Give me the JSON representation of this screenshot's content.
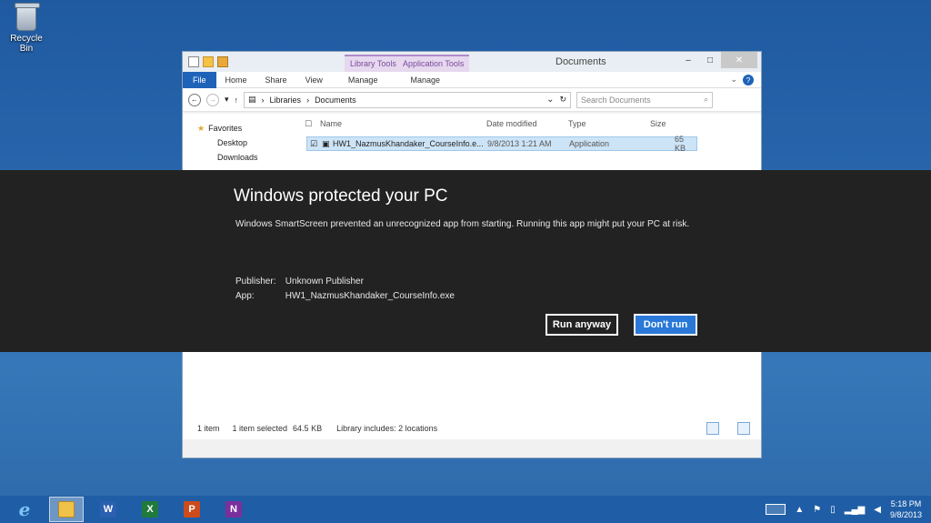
{
  "desktop": {
    "recycle_bin_label": "Recycle Bin"
  },
  "explorer": {
    "title": "Documents",
    "contextual_tabs": [
      "Library Tools",
      "Application Tools"
    ],
    "ribbon_tabs": [
      "File",
      "Home",
      "Share",
      "View",
      "Manage",
      "Manage"
    ],
    "path": [
      "Libraries",
      "Documents"
    ],
    "search_placeholder": "Search Documents",
    "nav_pane": {
      "favorites": "Favorites",
      "items": [
        "Desktop",
        "Downloads"
      ]
    },
    "columns": [
      "Name",
      "Date modified",
      "Type",
      "Size"
    ],
    "files": [
      {
        "name": "HW1_NazmusKhandaker_CourseInfo.e...",
        "date_modified": "9/8/2013 1:21 AM",
        "type": "Application",
        "size": "65 KB",
        "selected": true
      }
    ],
    "status": {
      "count": "1 item",
      "selection": "1 item selected",
      "size": "64.5 KB",
      "library": "Library includes: 2 locations"
    }
  },
  "smartscreen": {
    "title": "Windows protected your PC",
    "message": "Windows SmartScreen prevented an unrecognized app from starting. Running this app might put your PC at risk.",
    "publisher_label": "Publisher:",
    "publisher_value": "Unknown Publisher",
    "app_label": "App:",
    "app_value": "HW1_NazmusKhandaker_CourseInfo.exe",
    "run_anyway_label": "Run anyway",
    "dont_run_label": "Don't run"
  },
  "taskbar": {
    "apps": [
      {
        "icon": "internet-explorer-icon",
        "glyph": "e"
      },
      {
        "icon": "file-explorer-icon",
        "glyph": ""
      },
      {
        "icon": "word-icon",
        "glyph": "W"
      },
      {
        "icon": "excel-icon",
        "glyph": "X"
      },
      {
        "icon": "powerpoint-icon",
        "glyph": "P"
      },
      {
        "icon": "onenote-icon",
        "glyph": "N"
      }
    ],
    "time": "5:18 PM",
    "date": "9/8/2013"
  },
  "colors": {
    "accent": "#2a78d8",
    "smartscreen_bg": "#222222",
    "taskbar": "#1f5ea6"
  }
}
